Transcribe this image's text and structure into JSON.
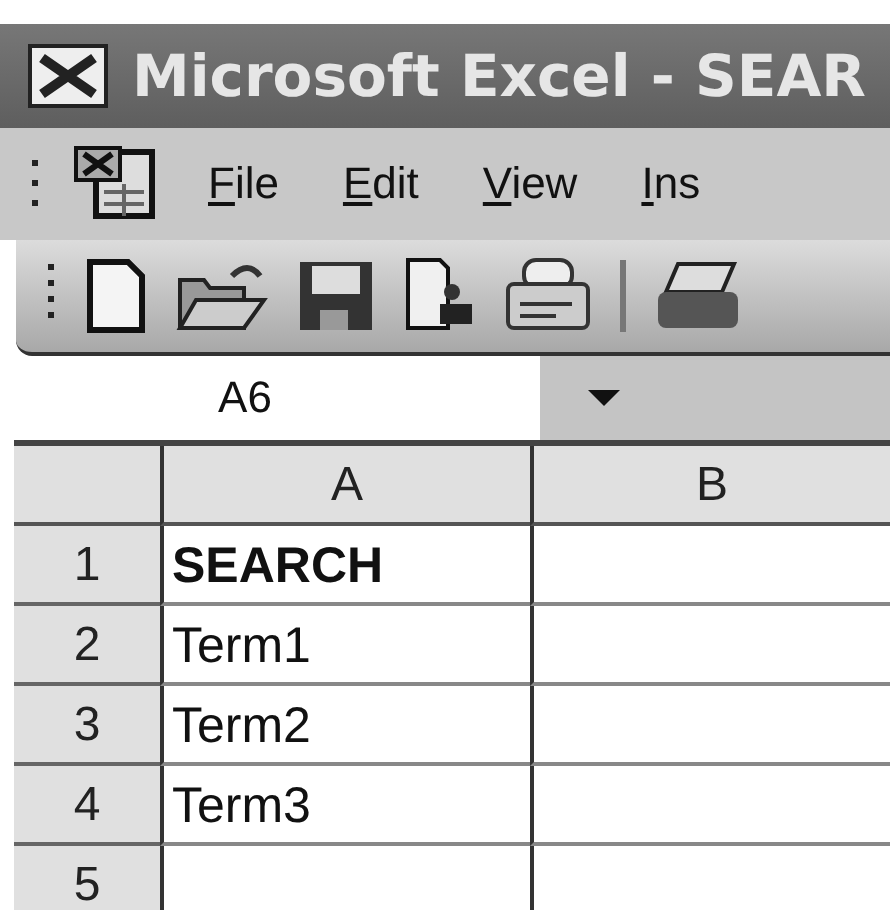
{
  "window": {
    "title": "Microsoft Excel - SEAR"
  },
  "menu": [
    {
      "label": "File"
    },
    {
      "label": "Edit"
    },
    {
      "label": "View"
    },
    {
      "label": "Ins"
    }
  ],
  "name_box": {
    "value": "A6"
  },
  "columns": [
    "A",
    "B"
  ],
  "rows": [
    {
      "header": "1",
      "cells": [
        {
          "text": "SEARCH",
          "bold": true
        }
      ]
    },
    {
      "header": "2",
      "cells": [
        {
          "text": "Term1",
          "bold": false
        }
      ]
    },
    {
      "header": "3",
      "cells": [
        {
          "text": "Term2",
          "bold": false
        }
      ]
    },
    {
      "header": "4",
      "cells": [
        {
          "text": "Term3",
          "bold": false
        }
      ]
    },
    {
      "header": "5"
    }
  ]
}
